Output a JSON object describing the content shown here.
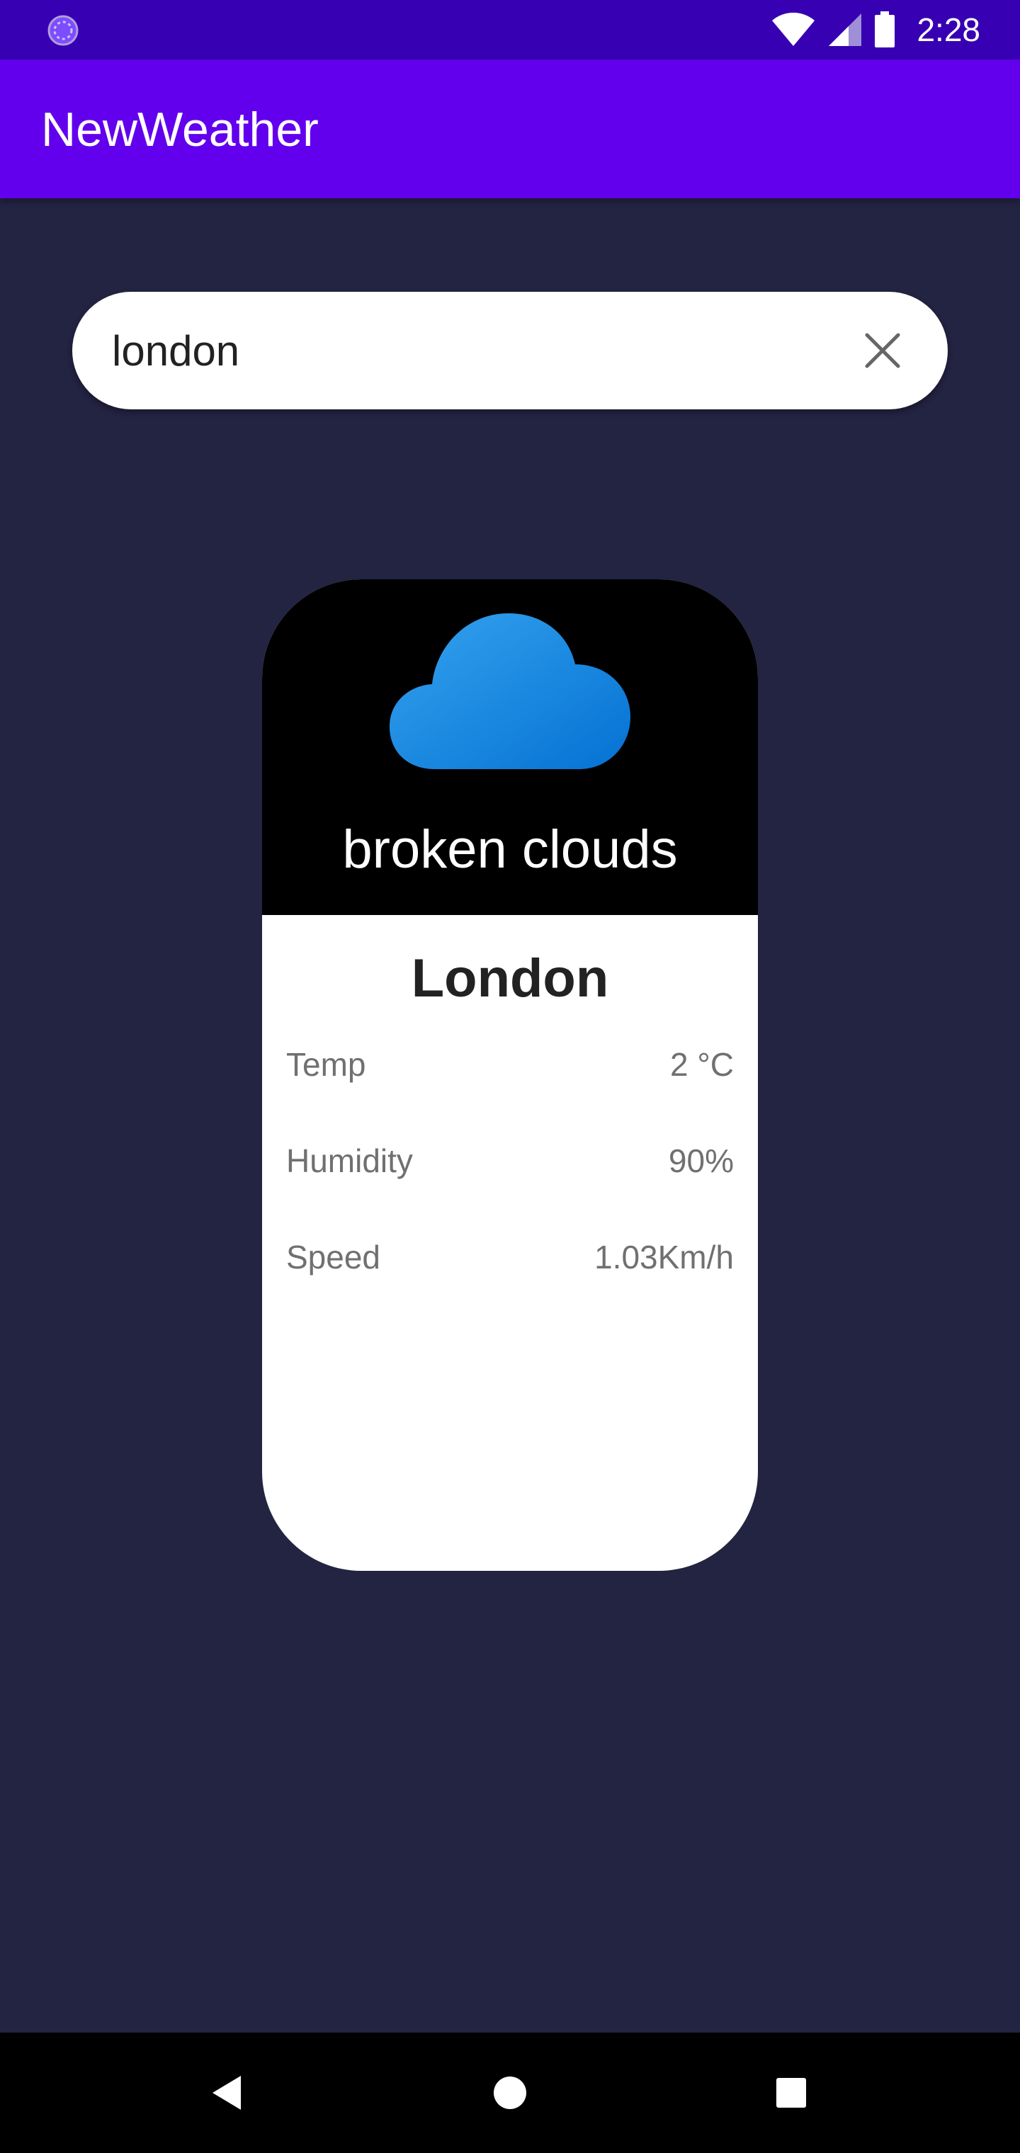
{
  "status_bar": {
    "time": "2:28",
    "left_icon": "sync-spinner-icon",
    "icons": [
      "wifi-icon",
      "signal-icon",
      "battery-icon"
    ]
  },
  "app_bar": {
    "title": "NewWeather",
    "color": "#6200ee"
  },
  "search": {
    "value": "london",
    "clear_icon": "close-icon"
  },
  "weather_card": {
    "icon": "cloud-icon",
    "description": "broken clouds",
    "city": "London",
    "stats": [
      {
        "label": "Temp",
        "value": "2 °C"
      },
      {
        "label": "Humidity",
        "value": "90%"
      },
      {
        "label": "Speed",
        "value": "1.03Km/h"
      }
    ]
  },
  "nav_bar": {
    "buttons": [
      "back-icon",
      "home-icon",
      "recents-icon"
    ]
  },
  "colors": {
    "background": "#232342",
    "status_bar": "#3700b3",
    "accent": "#6200ee",
    "cloud": "#1e88e5"
  }
}
